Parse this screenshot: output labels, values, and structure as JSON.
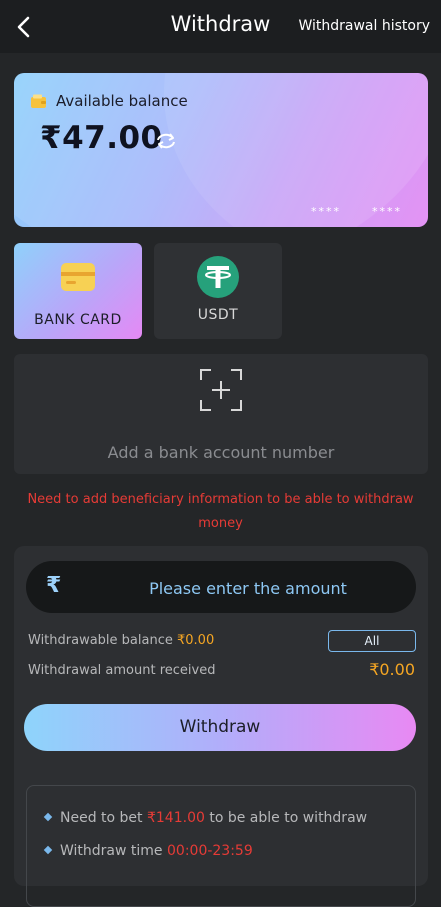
{
  "header": {
    "title": "Withdraw",
    "history_label": "Withdrawal history"
  },
  "balance": {
    "label": "Available balance",
    "amount": "₹47.00",
    "card_mask_1": "****",
    "card_mask_2": "****"
  },
  "payment_methods": [
    {
      "label": "BANK CARD",
      "active": true
    },
    {
      "label": "USDT",
      "active": false
    }
  ],
  "add_account": {
    "label": "Add a bank account number"
  },
  "warning": "Need to add beneficiary information to be able to withdraw money",
  "form": {
    "currency_symbol": "₹",
    "amount_placeholder": "Please enter the amount",
    "withdrawable_label": "Withdrawable balance",
    "withdrawable_value": "₹0.00",
    "all_label": "All",
    "received_label": "Withdrawal amount received",
    "received_value": "₹0.00",
    "withdraw_label": "Withdraw"
  },
  "rules": {
    "bet_prefix": "Need to bet",
    "bet_amount": "₹141.00",
    "bet_suffix": "to be able to withdraw",
    "time_label": "Withdraw time",
    "time_value": "00:00-23:59"
  },
  "colors": {
    "accent_blue": "#8ed0fb",
    "accent_pink": "#e589f4",
    "warning_red": "#e63b36",
    "value_orange": "#f5a623"
  },
  "icons": [
    "back-arrow-icon",
    "wallet-icon",
    "refresh-icon",
    "bank-card-icon",
    "usdt-icon",
    "add-scan-icon",
    "rupee-icon"
  ]
}
